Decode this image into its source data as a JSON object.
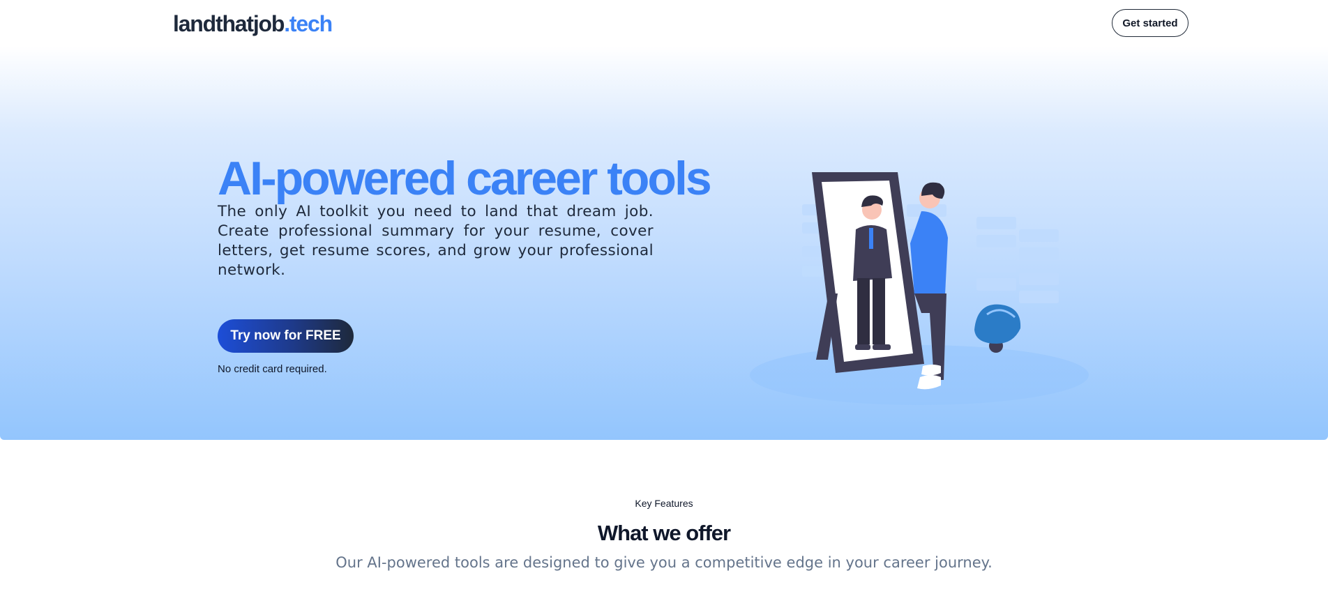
{
  "header": {
    "logo_main": "landthatjob",
    "logo_accent": ".tech",
    "get_started_label": "Get started"
  },
  "hero": {
    "title": "AI-powered career tools",
    "description": "The only AI toolkit you need to land that dream job. Create professional summary for your resume, cover letters, get resume scores, and grow your professional network.",
    "cta_label": "Try now for FREE",
    "note": "No credit card required."
  },
  "features": {
    "kicker": "Key Features",
    "title": "What we offer",
    "subtitle": "Our AI-powered tools are designed to give you a competitive edge in your career journey."
  },
  "colors": {
    "accent": "#3b82f6",
    "dark": "#0f172a",
    "hero_gradient_end": "#93c5fd"
  },
  "icons": {
    "illustration": "man-mirror-illustration"
  }
}
